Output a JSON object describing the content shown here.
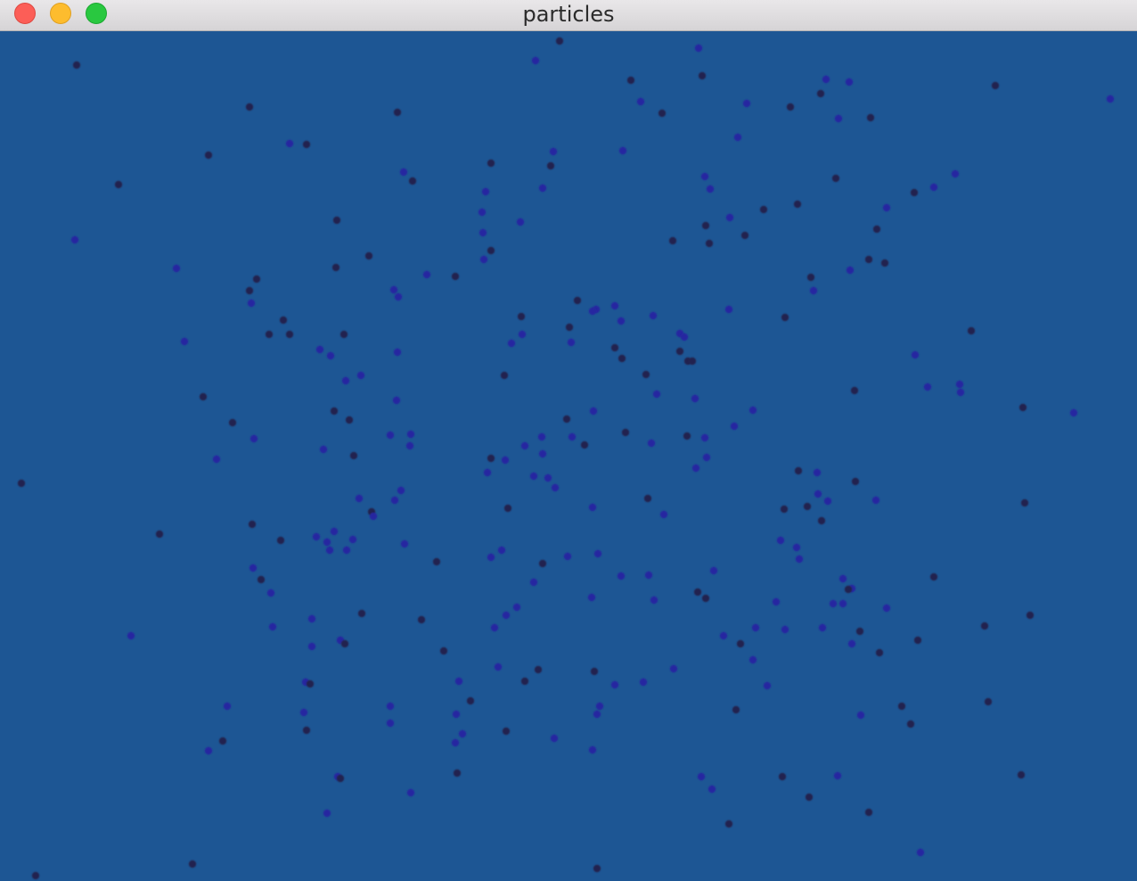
{
  "window": {
    "title": "particles"
  },
  "colors": {
    "background": "#1d5694",
    "particle_dark": "#23234f",
    "particle_blue": "#2626a0"
  },
  "icons": {
    "close": "close-icon",
    "minimize": "minimize-icon",
    "zoom": "zoom-icon"
  }
}
